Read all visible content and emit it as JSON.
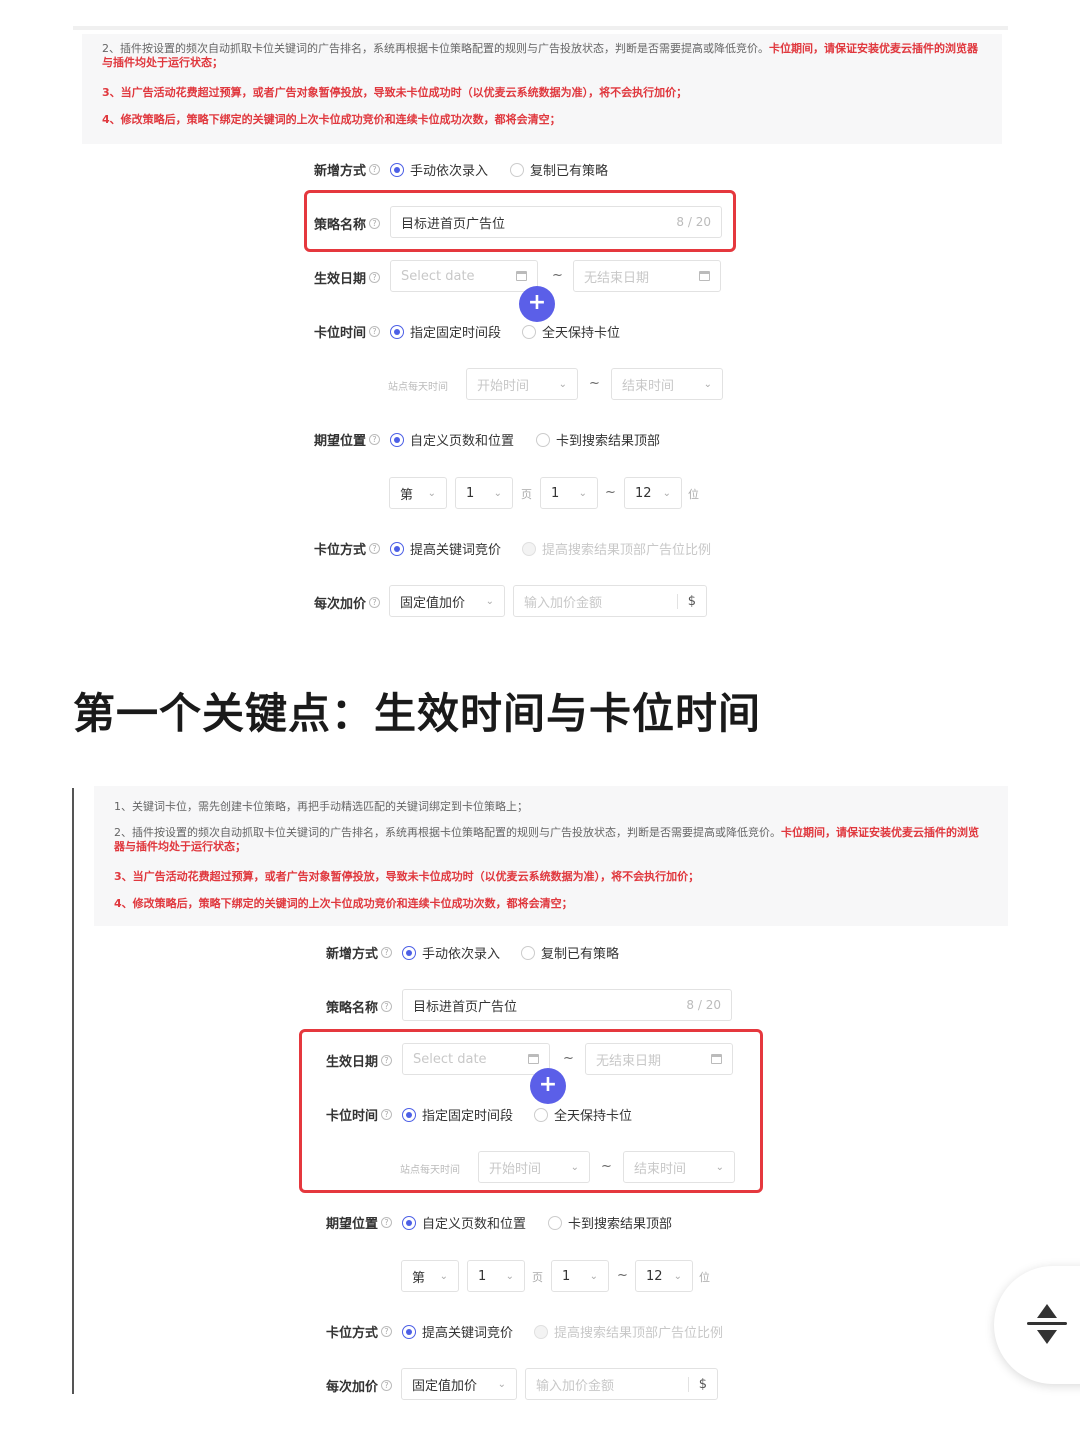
{
  "heading": "第一个关键点：生效时间与卡位时间",
  "notes": {
    "n1": "1、关键词卡位，需先创建卡位策略，再把手动精选匹配的关键词绑定到卡位策略上；",
    "n2a": "2、插件按设置的频次自动抓取卡位关键词的广告排名，系统再根据卡位策略配置的规则与广告投放状态，判断是否需要提高或降低竞价。",
    "n2b": "卡位期间，请保证安装优麦云插件的浏览器与插件均处于运行状态；",
    "n3": "3、当广告活动花费超过预算，或者广告对象暂停投放，导致未卡位成功时（以优麦云系统数据为准），将不会执行加价；",
    "n4": "4、修改策略后，策略下绑定的关键词的上次卡位成功竞价和连续卡位成功次数，都将会清空；"
  },
  "form": {
    "add_mode_label": "新增方式",
    "add_mode_opt1": "手动依次录入",
    "add_mode_opt2": "复制已有策略",
    "name_label": "策略名称",
    "name_value": "目标进首页广告位",
    "name_count": "8 / 20",
    "date_label": "生效日期",
    "date_start_placeholder": "Select date",
    "date_end_placeholder": "无结束日期",
    "date_sep": "~",
    "time_label": "卡位时间",
    "time_opt1": "指定固定时间段",
    "time_opt2": "全天保持卡位",
    "site_time_label": "站点每天时间",
    "start_time_placeholder": "开始时间",
    "end_time_placeholder": "结束时间",
    "pos_label": "期望位置",
    "pos_opt1": "自定义页数和位置",
    "pos_opt2": "卡到搜索结果顶部",
    "pos_prefix": "第",
    "pos_page": "1",
    "pos_page_unit": "页",
    "pos_from": "1",
    "pos_to": "12",
    "pos_unit": "位",
    "method_label": "卡位方式",
    "method_opt1": "提高关键词竞价",
    "method_opt2": "提高搜索结果顶部广告位比例",
    "bid_label": "每次加价",
    "bid_type": "固定值加价",
    "bid_placeholder": "输入加价金额",
    "bid_unit": "$",
    "plus": "+"
  },
  "colors": {
    "accent": "#4c5fe6",
    "highlight": "#e5383e",
    "plus_button": "#5b5fe8"
  }
}
